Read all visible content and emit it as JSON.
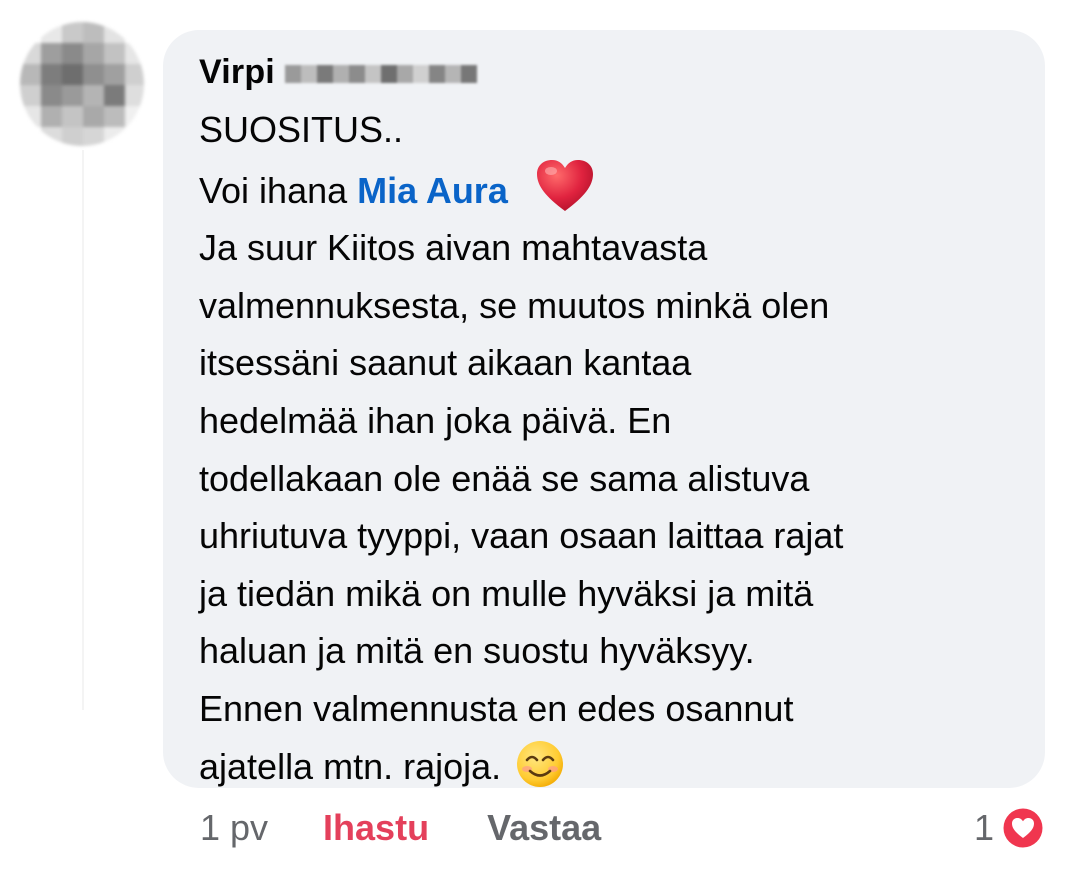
{
  "comment": {
    "author": "Virpi",
    "lines": {
      "l1": "SUOSITUS..",
      "l2_prefix": "Voi ihana ",
      "mention": "Mia Aura",
      "l3": "Ja suur Kiitos aivan mahtavasta",
      "l4": "valmennuksesta, se muutos minkä olen",
      "l5": "itsessäni saanut aikaan kantaa",
      "l6": "hedelmää ihan joka päivä. En",
      "l7": "todellakaan ole enää se sama alistuva",
      "l8": "uhriutuva tyyppi, vaan osaan laittaa rajat",
      "l9": "ja tiedän mikä on mulle hyväksi ja mitä",
      "l10": "haluan ja mitä en suostu hyväksyy.",
      "l11": "Ennen valmennusta en edes osannut",
      "l12": "ajatella mtn. rajoja."
    },
    "emoji": {
      "after_mention": "heart-emoji",
      "end": "smiling-face-emoji"
    }
  },
  "actions": {
    "time": "1 pv",
    "like_label": "Ihastu",
    "reply_label": "Vastaa"
  },
  "reactions": {
    "count": "1",
    "icon": "heart-reaction-icon"
  },
  "colors": {
    "bubble": "#f0f2f5",
    "mention": "#0a64c8",
    "like_active": "#e4405b",
    "meta": "#65676b",
    "heart": "#e0233f"
  }
}
